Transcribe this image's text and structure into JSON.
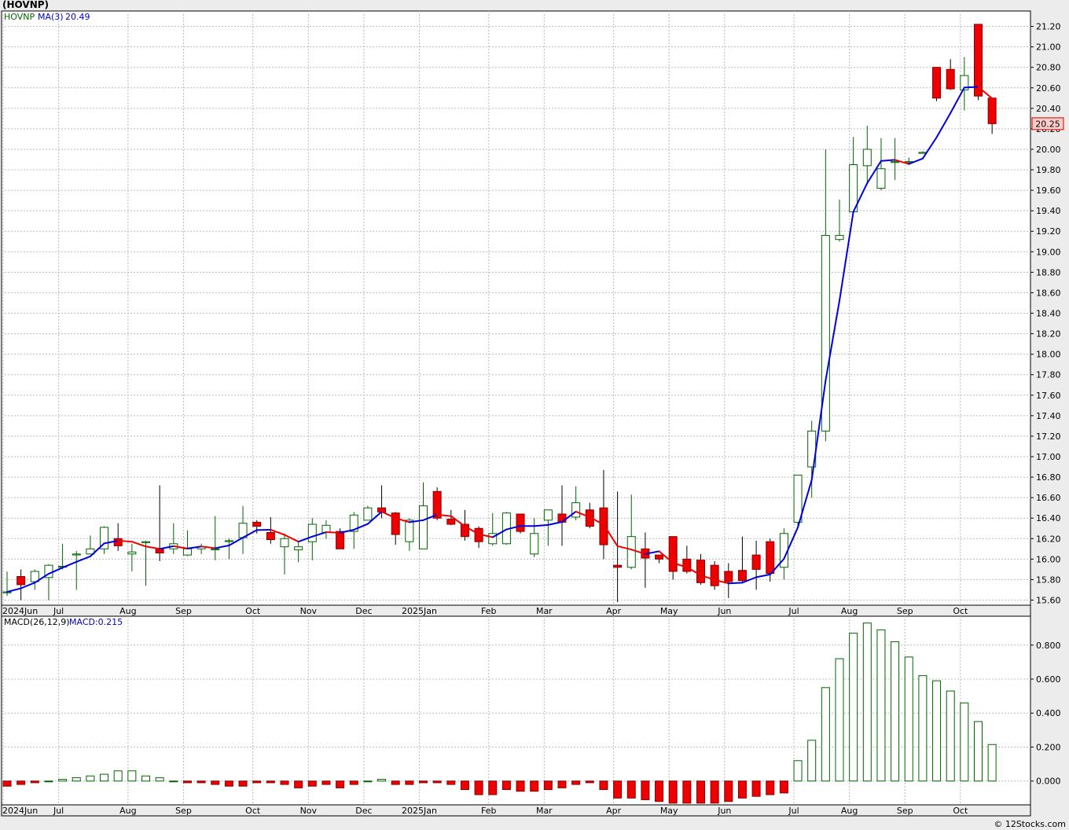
{
  "chart_data": {
    "type": "candlestick",
    "title": "(HOVNP)",
    "symbol_label": "HOVNP",
    "ma_label": "MA(3)",
    "ma_value_label": "20.49",
    "last_price_label": "20.25",
    "copyright": "© 12Stocks.com",
    "price_axis": {
      "ylim": [
        15.55,
        21.35
      ],
      "ticks": [
        "15.60",
        "15.80",
        "16.00",
        "16.20",
        "16.40",
        "16.60",
        "16.80",
        "17.00",
        "17.20",
        "17.40",
        "17.60",
        "17.80",
        "18.00",
        "18.20",
        "18.40",
        "18.60",
        "18.80",
        "19.00",
        "19.20",
        "19.40",
        "19.60",
        "19.80",
        "20.00",
        "20.20",
        "20.40",
        "20.60",
        "20.80",
        "21.00",
        "21.20"
      ]
    },
    "month_labels": [
      {
        "label": "2024Jun",
        "bar": 0
      },
      {
        "label": "Jul",
        "bar": 4
      },
      {
        "label": "Aug",
        "bar": 9
      },
      {
        "label": "Sep",
        "bar": 13
      },
      {
        "label": "Oct",
        "bar": 18
      },
      {
        "label": "Nov",
        "bar": 22
      },
      {
        "label": "Dec",
        "bar": 26
      },
      {
        "label": "2025Jan",
        "bar": 30
      },
      {
        "label": "Feb",
        "bar": 35
      },
      {
        "label": "Mar",
        "bar": 39
      },
      {
        "label": "Apr",
        "bar": 44
      },
      {
        "label": "May",
        "bar": 48
      },
      {
        "label": "Jun",
        "bar": 52
      },
      {
        "label": "Jul",
        "bar": 57
      },
      {
        "label": "Aug",
        "bar": 61
      },
      {
        "label": "Sep",
        "bar": 65
      },
      {
        "label": "Oct",
        "bar": 69
      }
    ],
    "candles": [
      {
        "o": 15.68,
        "h": 15.88,
        "l": 15.64,
        "c": 15.68
      },
      {
        "o": 15.83,
        "h": 15.9,
        "l": 15.6,
        "c": 15.75
      },
      {
        "o": 15.78,
        "h": 15.9,
        "l": 15.7,
        "c": 15.88
      },
      {
        "o": 15.82,
        "h": 15.95,
        "l": 15.6,
        "c": 15.94
      },
      {
        "o": 15.93,
        "h": 16.15,
        "l": 15.9,
        "c": 15.93
      },
      {
        "o": 16.05,
        "h": 16.08,
        "l": 15.7,
        "c": 16.05
      },
      {
        "o": 16.05,
        "h": 16.23,
        "l": 16.05,
        "c": 16.1
      },
      {
        "o": 16.1,
        "h": 16.32,
        "l": 16.05,
        "c": 16.31
      },
      {
        "o": 16.2,
        "h": 16.35,
        "l": 16.08,
        "c": 16.13
      },
      {
        "o": 16.05,
        "h": 16.15,
        "l": 15.88,
        "c": 16.07
      },
      {
        "o": 16.17,
        "h": 16.18,
        "l": 15.74,
        "c": 16.17
      },
      {
        "o": 16.1,
        "h": 16.72,
        "l": 15.98,
        "c": 16.06
      },
      {
        "o": 16.1,
        "h": 16.35,
        "l": 16.05,
        "c": 16.15
      },
      {
        "o": 16.04,
        "h": 16.28,
        "l": 16.03,
        "c": 16.1
      },
      {
        "o": 16.1,
        "h": 16.15,
        "l": 16.05,
        "c": 16.12
      },
      {
        "o": 16.1,
        "h": 16.42,
        "l": 15.99,
        "c": 16.1
      },
      {
        "o": 16.18,
        "h": 16.2,
        "l": 16.0,
        "c": 16.18
      },
      {
        "o": 16.21,
        "h": 16.52,
        "l": 16.05,
        "c": 16.35
      },
      {
        "o": 16.36,
        "h": 16.38,
        "l": 16.25,
        "c": 16.32
      },
      {
        "o": 16.26,
        "h": 16.41,
        "l": 16.15,
        "c": 16.19
      },
      {
        "o": 16.12,
        "h": 16.25,
        "l": 15.85,
        "c": 16.2
      },
      {
        "o": 16.09,
        "h": 16.16,
        "l": 15.97,
        "c": 16.12
      },
      {
        "o": 16.17,
        "h": 16.4,
        "l": 15.99,
        "c": 16.34
      },
      {
        "o": 16.26,
        "h": 16.38,
        "l": 16.2,
        "c": 16.33
      },
      {
        "o": 16.27,
        "h": 16.3,
        "l": 16.1,
        "c": 16.1
      },
      {
        "o": 16.27,
        "h": 16.46,
        "l": 16.1,
        "c": 16.43
      },
      {
        "o": 16.38,
        "h": 16.52,
        "l": 16.38,
        "c": 16.5
      },
      {
        "o": 16.5,
        "h": 16.72,
        "l": 16.4,
        "c": 16.46
      },
      {
        "o": 16.45,
        "h": 16.46,
        "l": 16.14,
        "c": 16.24
      },
      {
        "o": 16.17,
        "h": 16.4,
        "l": 16.08,
        "c": 16.38
      },
      {
        "o": 16.1,
        "h": 16.75,
        "l": 16.1,
        "c": 16.52
      },
      {
        "o": 16.66,
        "h": 16.7,
        "l": 16.38,
        "c": 16.4
      },
      {
        "o": 16.39,
        "h": 16.48,
        "l": 16.33,
        "c": 16.34
      },
      {
        "o": 16.34,
        "h": 16.48,
        "l": 16.18,
        "c": 16.22
      },
      {
        "o": 16.3,
        "h": 16.32,
        "l": 16.11,
        "c": 16.17
      },
      {
        "o": 16.15,
        "h": 16.45,
        "l": 16.13,
        "c": 16.25
      },
      {
        "o": 16.15,
        "h": 16.46,
        "l": 16.14,
        "c": 16.45
      },
      {
        "o": 16.44,
        "h": 16.44,
        "l": 16.25,
        "c": 16.27
      },
      {
        "o": 16.05,
        "h": 16.4,
        "l": 16.02,
        "c": 16.25
      },
      {
        "o": 16.38,
        "h": 16.43,
        "l": 16.13,
        "c": 16.48
      },
      {
        "o": 16.44,
        "h": 16.72,
        "l": 16.13,
        "c": 16.36
      },
      {
        "o": 16.41,
        "h": 16.71,
        "l": 16.38,
        "c": 16.55
      },
      {
        "o": 16.48,
        "h": 16.55,
        "l": 16.3,
        "c": 16.32
      },
      {
        "o": 16.5,
        "h": 16.87,
        "l": 16.0,
        "c": 16.14
      },
      {
        "o": 15.94,
        "h": 16.66,
        "l": 15.58,
        "c": 15.92
      },
      {
        "o": 15.92,
        "h": 16.63,
        "l": 15.9,
        "c": 16.22
      },
      {
        "o": 16.1,
        "h": 16.26,
        "l": 15.72,
        "c": 16.01
      },
      {
        "o": 16.04,
        "h": 16.04,
        "l": 15.96,
        "c": 16.0
      },
      {
        "o": 16.22,
        "h": 16.22,
        "l": 15.8,
        "c": 15.88
      },
      {
        "o": 16.0,
        "h": 16.13,
        "l": 15.86,
        "c": 15.88
      },
      {
        "o": 15.99,
        "h": 16.05,
        "l": 15.75,
        "c": 15.77
      },
      {
        "o": 15.94,
        "h": 15.98,
        "l": 15.7,
        "c": 15.74
      },
      {
        "o": 15.88,
        "h": 15.96,
        "l": 15.62,
        "c": 15.78
      },
      {
        "o": 15.89,
        "h": 16.22,
        "l": 15.77,
        "c": 15.79
      },
      {
        "o": 16.04,
        "h": 16.18,
        "l": 15.7,
        "c": 15.9
      },
      {
        "o": 16.17,
        "h": 16.2,
        "l": 15.78,
        "c": 15.86
      },
      {
        "o": 15.92,
        "h": 16.3,
        "l": 15.8,
        "c": 16.25
      },
      {
        "o": 16.36,
        "h": 16.82,
        "l": 16.3,
        "c": 16.82
      },
      {
        "o": 16.9,
        "h": 17.35,
        "l": 16.6,
        "c": 17.25
      },
      {
        "o": 17.25,
        "h": 20.0,
        "l": 17.15,
        "c": 19.16
      },
      {
        "o": 19.12,
        "h": 19.51,
        "l": 19.1,
        "c": 19.16
      },
      {
        "o": 19.39,
        "h": 20.12,
        "l": 19.38,
        "c": 19.85
      },
      {
        "o": 19.84,
        "h": 20.23,
        "l": 19.68,
        "c": 20.0
      },
      {
        "o": 19.62,
        "h": 20.11,
        "l": 19.6,
        "c": 19.81
      },
      {
        "o": 19.88,
        "h": 20.11,
        "l": 19.7,
        "c": 19.88
      },
      {
        "o": 19.88,
        "h": 19.92,
        "l": 19.85,
        "c": 19.88
      },
      {
        "o": 19.97,
        "h": 19.98,
        "l": 19.96,
        "c": 19.97
      },
      {
        "o": 20.8,
        "h": 20.8,
        "l": 20.47,
        "c": 20.5
      },
      {
        "o": 20.78,
        "h": 20.88,
        "l": 20.58,
        "c": 20.59
      },
      {
        "o": 20.58,
        "h": 20.9,
        "l": 20.38,
        "c": 20.72
      },
      {
        "o": 21.22,
        "h": 21.22,
        "l": 20.48,
        "c": 20.52
      },
      {
        "o": 20.5,
        "h": 20.5,
        "l": 20.15,
        "c": 20.25
      }
    ],
    "macd": {
      "label": "MACD(26,12,9)",
      "value_label": "MACD:0.215",
      "ylim": [
        -0.14,
        0.97
      ],
      "ticks": [
        "0.000",
        "0.200",
        "0.400",
        "0.600",
        "0.800"
      ],
      "values": [
        -0.03,
        -0.02,
        -0.01,
        0.0,
        0.01,
        0.02,
        0.03,
        0.04,
        0.06,
        0.06,
        0.03,
        0.02,
        0.0,
        -0.01,
        -0.01,
        -0.02,
        -0.03,
        -0.03,
        -0.01,
        -0.01,
        -0.02,
        -0.04,
        -0.03,
        -0.02,
        -0.04,
        -0.02,
        0.0,
        0.01,
        -0.02,
        -0.02,
        -0.01,
        -0.01,
        -0.02,
        -0.05,
        -0.08,
        -0.08,
        -0.05,
        -0.06,
        -0.06,
        -0.05,
        -0.04,
        -0.02,
        -0.01,
        -0.05,
        -0.1,
        -0.1,
        -0.11,
        -0.12,
        -0.13,
        -0.13,
        -0.13,
        -0.13,
        -0.12,
        -0.1,
        -0.09,
        -0.08,
        -0.07,
        0.12,
        0.24,
        0.55,
        0.72,
        0.87,
        0.93,
        0.89,
        0.82,
        0.73,
        0.62,
        0.59,
        0.53,
        0.46,
        0.35,
        0.215
      ]
    }
  }
}
